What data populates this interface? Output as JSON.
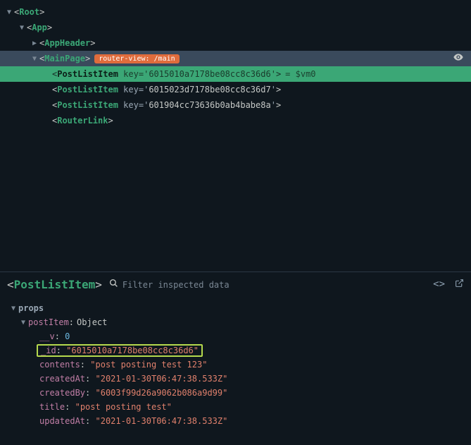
{
  "tree": {
    "root": {
      "tag": "Root"
    },
    "app": {
      "tag": "App"
    },
    "header": {
      "tag": "AppHeader"
    },
    "mainpage": {
      "tag": "MainPage",
      "badge": "router-view: /main"
    },
    "items": [
      {
        "tag": "PostListItem",
        "attr_name": "key",
        "attr_value": "6015010a7178be08cc8c36d6",
        "vm": " = $vm0",
        "selected": true
      },
      {
        "tag": "PostListItem",
        "attr_name": "key",
        "attr_value": "6015023d7178be08cc8c36d7"
      },
      {
        "tag": "PostListItem",
        "attr_name": "key",
        "attr_value": "601904cc73636b0ab4babe8a"
      }
    ],
    "routerlink": {
      "tag": "RouterLink"
    }
  },
  "bottom": {
    "selected_tag": "PostListItem",
    "search_placeholder": "Filter inspected data",
    "section": "props",
    "obj_key": "postItem",
    "obj_type": "Object",
    "v_key": "__v",
    "v_val": "0",
    "id_key": "_id",
    "id_val": "\"6015010a7178be08cc8c36d6\"",
    "contents_key": "contents",
    "contents_val": "\"post posting test 123\"",
    "createdAt_key": "createdAt",
    "createdAt_val": "\"2021-01-30T06:47:38.533Z\"",
    "createdBy_key": "createdBy",
    "createdBy_val": "\"6003f99d26a9062b086a9d99\"",
    "title_key": "title",
    "title_val": "\"post posting test\"",
    "updatedAt_key": "updatedAt",
    "updatedAt_val": "\"2021-01-30T06:47:38.533Z\""
  }
}
